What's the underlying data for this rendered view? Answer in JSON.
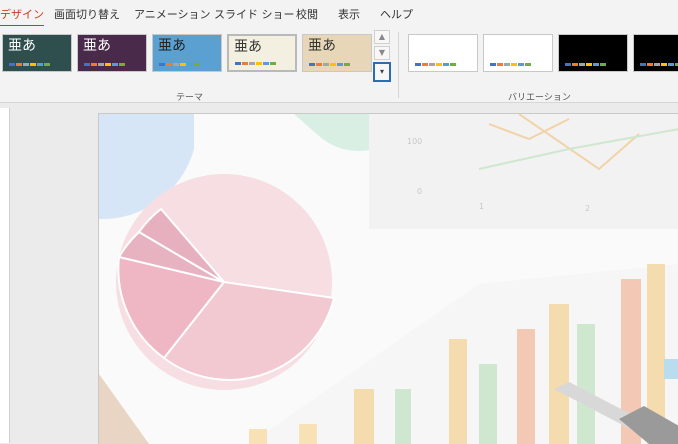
{
  "tabs": [
    {
      "label": "デザイン",
      "active": true
    },
    {
      "label": "画面切り替え"
    },
    {
      "label": "アニメーション"
    },
    {
      "label": "スライド ショー"
    },
    {
      "label": "校閲"
    },
    {
      "label": "表示"
    },
    {
      "label": "ヘルプ"
    }
  ],
  "themes": {
    "group_label": "テーマ",
    "items": [
      {
        "text": "亜あ",
        "bg": "#2f4f4f",
        "fg": "#ffffff"
      },
      {
        "text": "亜あ",
        "bg": "#4a2a4a",
        "fg": "#ffffff"
      },
      {
        "text": "亜あ",
        "bg": "#5aa0d0",
        "fg": "#222222"
      },
      {
        "text": "亜あ",
        "bg": "#f3f0e2",
        "fg": "#333333"
      },
      {
        "text": "亜あ",
        "bg": "#e8d6b8",
        "fg": "#333333"
      }
    ]
  },
  "variations": {
    "group_label": "バリエーション",
    "items": [
      {
        "bg": "#ffffff"
      },
      {
        "bg": "#ffffff"
      },
      {
        "bg": "#000000"
      },
      {
        "bg": "#000000"
      }
    ]
  },
  "gallery_buttons": {
    "up": "▲",
    "down": "▼",
    "more": "▾"
  },
  "slide": {
    "chart_ticks": [
      "100",
      "0",
      "1",
      "2"
    ]
  },
  "colors": {
    "accent": "#c43e1c",
    "focus": "#2b6cb2",
    "swatch_row": [
      "#4472c4",
      "#ed7d31",
      "#a5a5a5",
      "#ffc000",
      "#5b9bd5",
      "#70ad47"
    ]
  }
}
